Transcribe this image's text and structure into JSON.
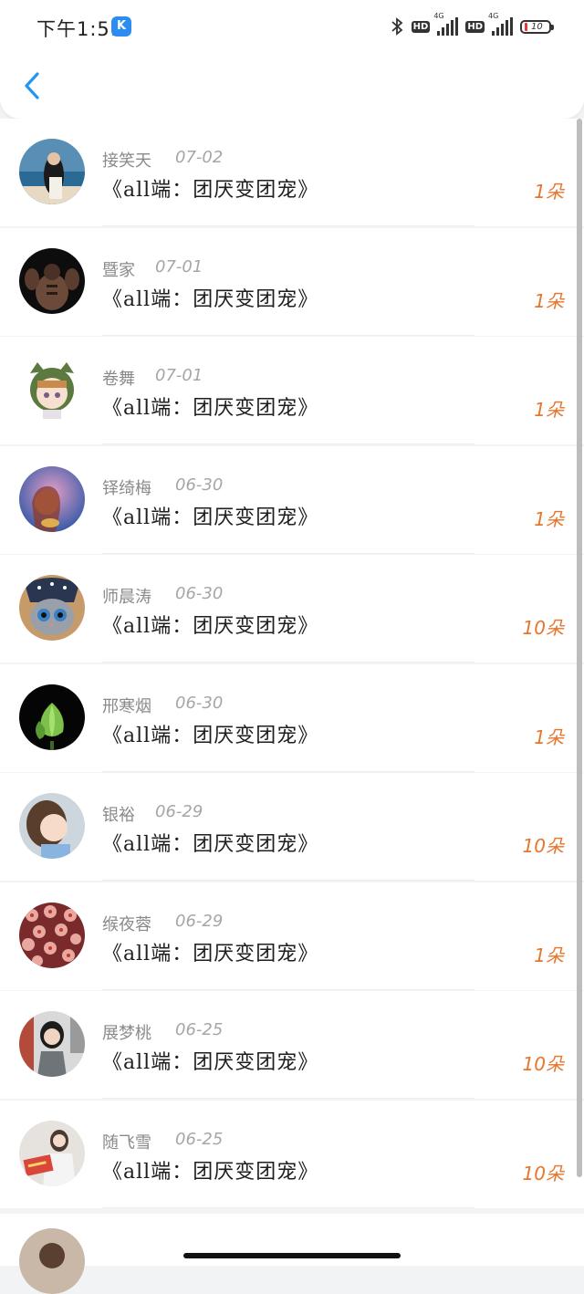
{
  "status_bar": {
    "time": "下午1:51",
    "app_badge": "K",
    "network_label": "4G",
    "hd_label": "HD",
    "battery_text": "10",
    "battery_color": "#e53935"
  },
  "nav": {
    "back_icon": "chevron-left-icon",
    "accent_color": "#2196f3"
  },
  "rows": [
    {
      "name": "接笑天",
      "date": "07-02",
      "title": "《all端：团厌变团宠》",
      "count": "1朵"
    },
    {
      "name": "暨家",
      "date": "07-01",
      "title": "《all端：团厌变团宠》",
      "count": "1朵"
    },
    {
      "name": "卷舞",
      "date": "07-01",
      "title": "《all端：团厌变团宠》",
      "count": "1朵"
    },
    {
      "name": "铎绮梅",
      "date": "06-30",
      "title": "《all端：团厌变团宠》",
      "count": "1朵"
    },
    {
      "name": "师晨涛",
      "date": "06-30",
      "title": "《all端：团厌变团宠》",
      "count": "10朵"
    },
    {
      "name": "邢寒烟",
      "date": "06-30",
      "title": "《all端：团厌变团宠》",
      "count": "1朵"
    },
    {
      "name": "银裕",
      "date": "06-29",
      "title": "《all端：团厌变团宠》",
      "count": "10朵"
    },
    {
      "name": "缑夜蓉",
      "date": "06-29",
      "title": "《all端：团厌变团宠》",
      "count": "1朵"
    },
    {
      "name": "展梦桃",
      "date": "06-25",
      "title": "《all端：团厌变团宠》",
      "count": "10朵"
    },
    {
      "name": "随飞雪",
      "date": "06-25",
      "title": "《all端：团厌变团宠》",
      "count": "10朵"
    }
  ],
  "colors": {
    "count": "#e8752c",
    "name": "#8a8a8a",
    "title": "#1e1e1e"
  }
}
